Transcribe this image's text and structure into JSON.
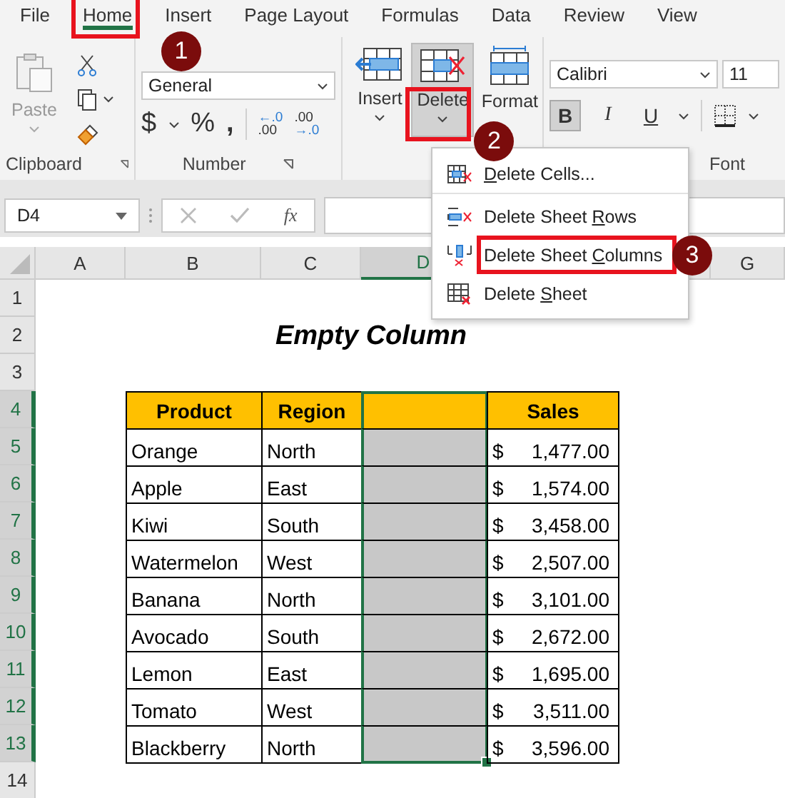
{
  "ribbon_tabs": [
    {
      "label": "File",
      "selected": false
    },
    {
      "label": "Home",
      "selected": true,
      "callout": "1"
    },
    {
      "label": "Insert",
      "selected": false
    },
    {
      "label": "Page Layout",
      "selected": false
    },
    {
      "label": "Formulas",
      "selected": false
    },
    {
      "label": "Data",
      "selected": false
    },
    {
      "label": "Review",
      "selected": false
    },
    {
      "label": "View",
      "selected": false
    }
  ],
  "ribbon": {
    "clipboard": {
      "paste": "Paste",
      "label": "Clipboard"
    },
    "number": {
      "format": "General",
      "currency": "$",
      "percent": "%",
      "comma": ",",
      "increase_decimal": [
        "←.0",
        ".00"
      ],
      "decrease_decimal": [
        ".00",
        "→.0"
      ],
      "label": "Number"
    },
    "cells": {
      "buttons": [
        {
          "kind": "insert",
          "label": "Insert",
          "pressed": false
        },
        {
          "kind": "delete",
          "label": "Delete",
          "pressed": true,
          "callout": "2"
        },
        {
          "kind": "format",
          "label": "Format",
          "pressed": false
        }
      ]
    },
    "font": {
      "name": "Calibri",
      "size": "11",
      "styles": [
        {
          "kind": "bold",
          "label": "B",
          "pressed": true
        },
        {
          "kind": "italic",
          "label": "I",
          "pressed": false
        },
        {
          "kind": "underline",
          "label": "U",
          "pressed": false
        }
      ],
      "label": "Font"
    }
  },
  "delete_menu": [
    {
      "kind": "cells",
      "key": "D",
      "after": "elete Cells..."
    },
    {
      "kind": "rows",
      "before": "Delete Sheet ",
      "key": "R",
      "after": "ows"
    },
    {
      "kind": "columns",
      "before": "Delete Sheet ",
      "key": "C",
      "after": "olumns",
      "callout": "3"
    },
    {
      "kind": "sheet",
      "before": "Delete ",
      "key": "S",
      "after": "heet"
    }
  ],
  "formula_bar": {
    "name_box": "D4",
    "fx": "fx"
  },
  "sheet": {
    "columns": [
      {
        "label": "A",
        "selected": false
      },
      {
        "label": "B",
        "selected": false
      },
      {
        "label": "C",
        "selected": false
      },
      {
        "label": "D",
        "selected": true
      },
      {
        "label": "G",
        "selected": false
      }
    ],
    "rows": [
      {
        "number": "1",
        "selected": false,
        "kind": "blank"
      },
      {
        "number": "2",
        "selected": false,
        "kind": "title",
        "title": "Empty Column"
      },
      {
        "number": "3",
        "selected": false,
        "kind": "blank"
      },
      {
        "number": "4",
        "selected": true,
        "kind": "header",
        "cells": [
          "Product",
          "Region",
          "Sales"
        ]
      },
      {
        "number": "5",
        "selected": true,
        "kind": "data",
        "product": "Orange",
        "region": "North",
        "currency": "$",
        "sales": "1,477.00"
      },
      {
        "number": "6",
        "selected": true,
        "kind": "data",
        "product": "Apple",
        "region": "East",
        "currency": "$",
        "sales": "1,574.00"
      },
      {
        "number": "7",
        "selected": true,
        "kind": "data",
        "product": "Kiwi",
        "region": "South",
        "currency": "$",
        "sales": "3,458.00"
      },
      {
        "number": "8",
        "selected": true,
        "kind": "data",
        "product": "Watermelon",
        "region": "West",
        "currency": "$",
        "sales": "2,507.00"
      },
      {
        "number": "9",
        "selected": true,
        "kind": "data",
        "product": "Banana",
        "region": "North",
        "currency": "$",
        "sales": "3,101.00"
      },
      {
        "number": "10",
        "selected": true,
        "kind": "data",
        "product": "Avocado",
        "region": "South",
        "currency": "$",
        "sales": "2,672.00"
      },
      {
        "number": "11",
        "selected": true,
        "kind": "data",
        "product": "Lemon",
        "region": "East",
        "currency": "$",
        "sales": "1,695.00"
      },
      {
        "number": "12",
        "selected": true,
        "kind": "data",
        "product": "Tomato",
        "region": "West",
        "currency": "$",
        "sales": "3,511.00"
      },
      {
        "number": "13",
        "selected": true,
        "kind": "data",
        "product": "Blackberry",
        "region": "North",
        "currency": "$",
        "sales": "3,596.00"
      },
      {
        "number": "14",
        "selected": false,
        "kind": "blank"
      }
    ]
  }
}
